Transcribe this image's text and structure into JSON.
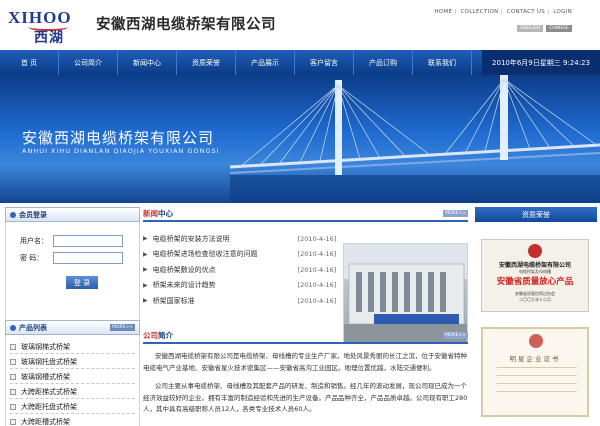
{
  "header": {
    "logo_en": "XIHOO",
    "logo_cn": "西湖",
    "company_name": "安徽西湖电缆桥架有限公司",
    "top_links": [
      "HOME",
      "COLLECTION",
      "CONTACT US",
      "LOGIN"
    ],
    "languages": [
      "ENGLISH",
      "CHINESE"
    ]
  },
  "nav": {
    "items": [
      "首  页",
      "公司简介",
      "新闻中心",
      "资质荣誉",
      "产品展示",
      "客户留言",
      "产品订购",
      "联系我们"
    ],
    "datetime": "2010年6月9日星期三  9:24:23"
  },
  "banner": {
    "title": "安徽西湖电缆桥架有限公司",
    "subtitle": "ANHUI XIHU DIANLAN QIAOJIA YOUXIAN GONGSI"
  },
  "login": {
    "heading": "会员登录",
    "username_label": "用户名：",
    "password_label": "密  码：",
    "submit": "登 录"
  },
  "products": {
    "heading": "产品列表",
    "more": "MORE>>",
    "items": [
      "玻璃钢梯式桥架",
      "玻璃钢托盘式桥架",
      "玻璃钢槽式桥架",
      "大跨距梯式式桥架",
      "大跨距托盘式桥架",
      "大跨距槽式桥架"
    ]
  },
  "news": {
    "heading_a": "新闻",
    "heading_b": "中心",
    "more": "MORE>>",
    "items": [
      {
        "title": "电缆桥架的安装方法说明",
        "date": "[2010-4-16]"
      },
      {
        "title": "电缆桥架进场检查验收注意的问题",
        "date": "[2010-4-16]"
      },
      {
        "title": "电缆桥架敷设的优点",
        "date": "[2010-4-16]"
      },
      {
        "title": "桥架未来的设计趋势",
        "date": "[2010-4-16]"
      },
      {
        "title": "桥架国家标准",
        "date": "[2010-4-16]"
      }
    ]
  },
  "intro": {
    "heading_a": "公司",
    "heading_b": "简介",
    "more": "MORE>>",
    "paragraphs": [
      "安徽西湖电缆桥架有限公司是电缆桥架、母线槽的专业生产厂家。地处风景秀丽的长江之滨，位于安徽省特种电缆电气产业基地、安徽省星火技术密集区——安徽省高沟工业园区。地理位置优越，水陆交通便利。",
      "公司主要从事电缆桥架、母线槽及其配套产品的研发、制造和销售。经几年的滚动发展，现公司现已成为一个经济效益较好的企业。拥有丰富的制造经验和先进的生产设备。产品品种齐全，产品品质卓越。公司现有职工280人，其中具有高级职称人员12人，各类专业技术人员60人。"
    ]
  },
  "honors": {
    "heading": "资质荣誉",
    "cert1": {
      "line1": "安徽西湖电缆桥架有限公司",
      "line2": "电缆桥架及母线槽",
      "line3": "安徽省质量放心产品",
      "line4": "安徽省质量信得过协会",
      "line5": "二〇〇九年十二月"
    },
    "cert2": {
      "title": "明星企业证书"
    }
  }
}
